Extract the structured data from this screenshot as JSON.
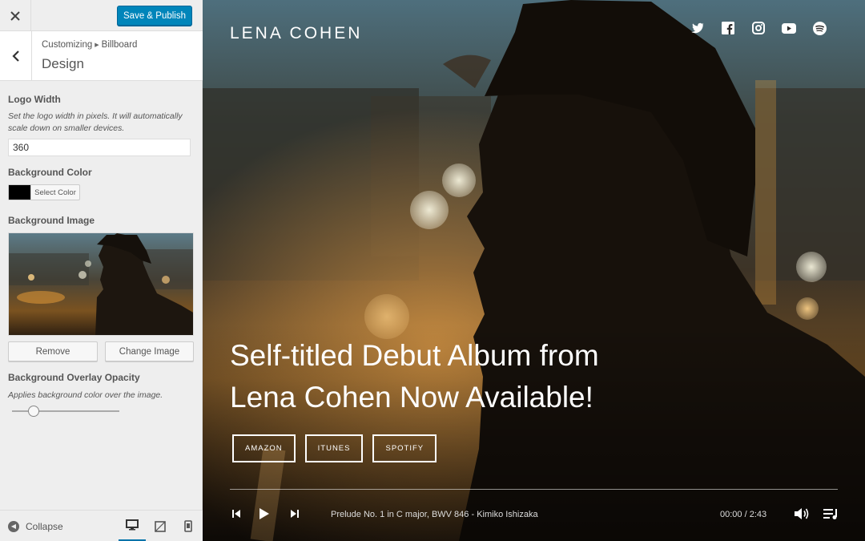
{
  "header": {
    "close_icon": "close-icon",
    "publish_label": "Save & Publish",
    "accent_color": "#0085ba"
  },
  "panel": {
    "breadcrumb_root": "Customizing",
    "breadcrumb_section": "Billboard",
    "title": "Design"
  },
  "controls": {
    "logo_width": {
      "label": "Logo Width",
      "description": "Set the logo width in pixels. It will automatically scale down on smaller devices.",
      "value": "360"
    },
    "background_color": {
      "label": "Background Color",
      "button_label": "Select Color",
      "value": "#000000"
    },
    "background_image": {
      "label": "Background Image",
      "remove_label": "Remove",
      "change_label": "Change Image"
    },
    "overlay_opacity": {
      "label": "Background Overlay Opacity",
      "description": "Applies background color over the image.",
      "value": 0.2
    }
  },
  "footer": {
    "collapse_label": "Collapse",
    "devices": [
      "desktop",
      "tablet",
      "mobile"
    ],
    "active_device": "desktop"
  },
  "preview": {
    "site_title": "LENA COHEN",
    "social_icons": [
      "twitter-icon",
      "facebook-icon",
      "instagram-icon",
      "youtube-icon",
      "spotify-icon"
    ],
    "headline_line1": "Self-titled Debut Album from",
    "headline_line2": "Lena Cohen Now Available!",
    "store_buttons": [
      "AMAZON",
      "ITUNES",
      "SPOTIFY"
    ],
    "player": {
      "track": "Prelude No. 1 in C major, BWV 846 - Kimiko Ishizaka",
      "time": "00:00 / 2:43"
    }
  }
}
